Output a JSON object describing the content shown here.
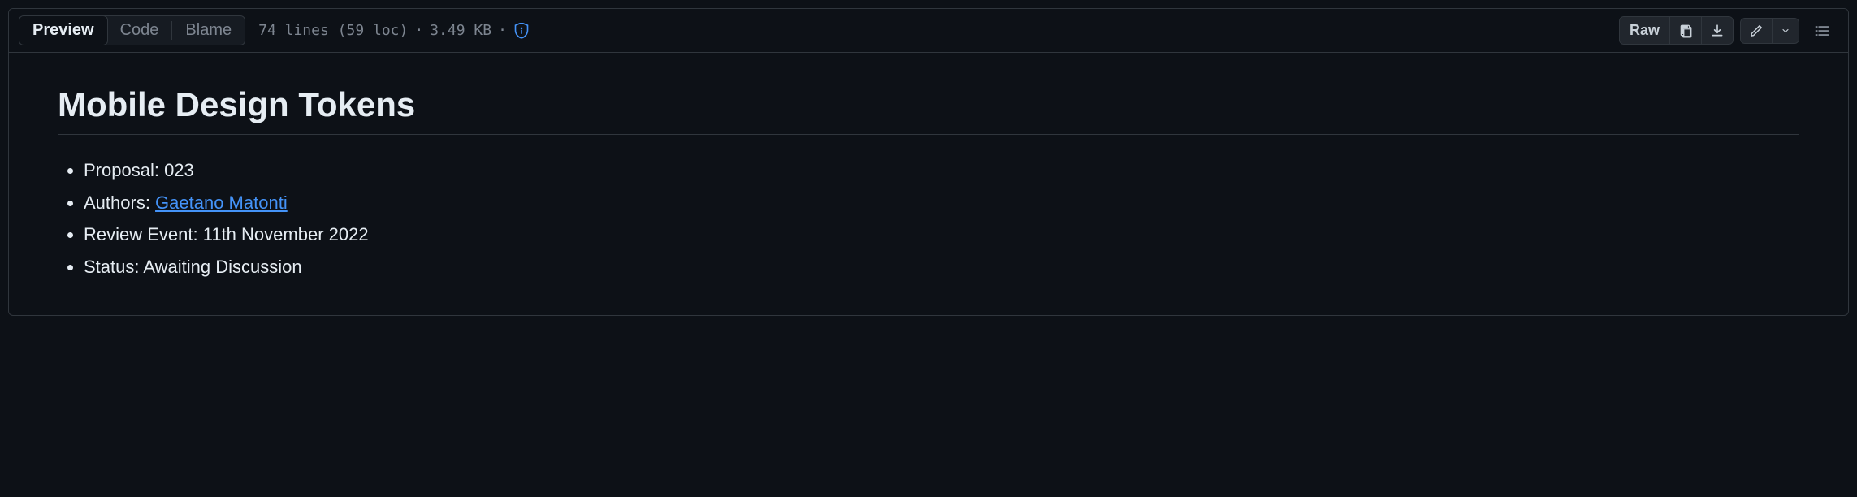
{
  "toolbar": {
    "tabs": {
      "preview": "Preview",
      "code": "Code",
      "blame": "Blame"
    },
    "file_info": {
      "lines": "74 lines (59 loc)",
      "size": "3.49 KB"
    },
    "actions": {
      "raw": "Raw"
    }
  },
  "document": {
    "title": "Mobile Design Tokens",
    "meta": {
      "proposal_label": "Proposal: ",
      "proposal_value": "023",
      "authors_label": "Authors: ",
      "author_name": "Gaetano Matonti",
      "review_label": "Review Event: ",
      "review_value": "11th November 2022",
      "status_label": "Status: ",
      "status_value": "Awaiting Discussion"
    }
  }
}
